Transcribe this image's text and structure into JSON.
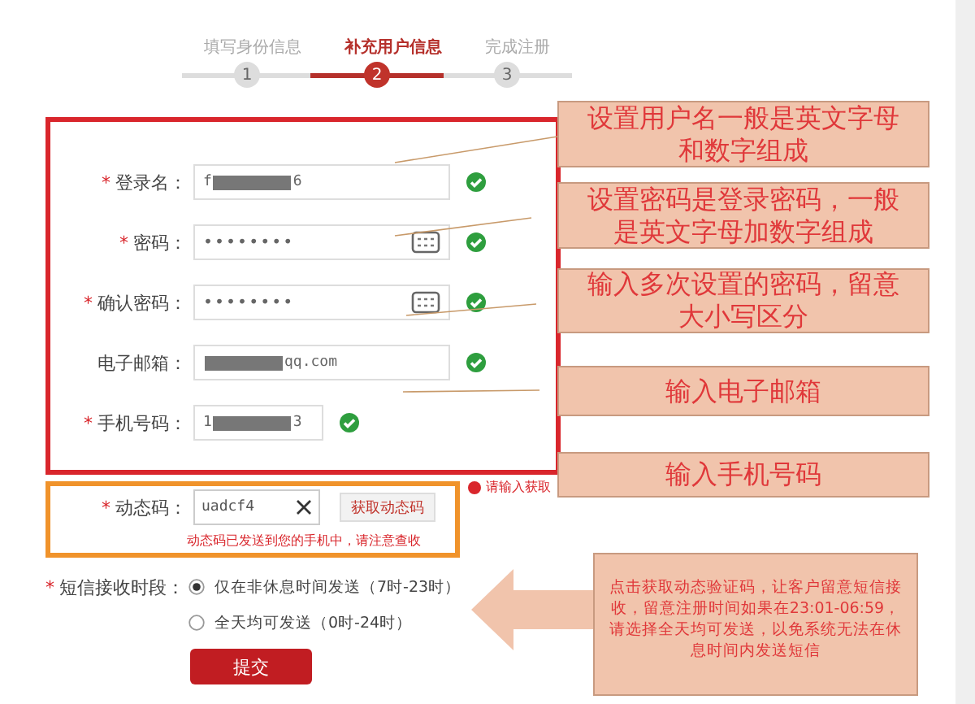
{
  "steps": [
    {
      "label": "填写身份信息",
      "number": "1",
      "selected": false
    },
    {
      "label": "补充用户信息",
      "number": "2",
      "selected": true
    },
    {
      "label": "完成注册",
      "number": "3",
      "selected": false
    }
  ],
  "fields": [
    {
      "mark": "*",
      "label": "登录名：",
      "kind": "text",
      "prefix": "f",
      "suffix": "6",
      "masked": true,
      "valid": true
    },
    {
      "mark": "*",
      "label": "密码：",
      "kind": "password",
      "prefix": "••••••••",
      "valid": true
    },
    {
      "mark": "*",
      "label": "确认密码：",
      "kind": "password",
      "prefix": "••••••••",
      "valid": true
    },
    {
      "label": "电子邮箱：",
      "kind": "text",
      "suffix": "qq.com",
      "masked": true,
      "valid": true
    },
    {
      "mark": "*",
      "label": "手机号码：",
      "kind": "short",
      "prefix": "1",
      "suffix": "3",
      "masked": true,
      "valid": true
    }
  ],
  "code": {
    "mark": "*",
    "label": "动态码：",
    "value": "uadcf4",
    "button": "获取动态码",
    "hint": "动态码已发送到您的手机中，请注意查收",
    "error": "请输入获取"
  },
  "sms": {
    "mark": "*",
    "label": "短信接收时段：",
    "options": [
      {
        "label": "仅在非休息时间发送（7时-23时）",
        "selected": true
      },
      {
        "label": "全天均可发送（0时-24时）",
        "selected": false
      }
    ]
  },
  "submit": "提交",
  "annotations": [
    "设置用户名一般是英文字母和数字组成",
    "设置密码是登录密码，一般是英文字母加数字组成",
    "输入多次设置的密码，留意大小写区分",
    "输入电子邮箱",
    "输入手机号码"
  ],
  "callout": "点击获取动态验证码，让客户留意短信接收，留意注册时间如果在23:01-06:59，请选择全天均可发送，以免系统无法在休息时间内发送短信"
}
